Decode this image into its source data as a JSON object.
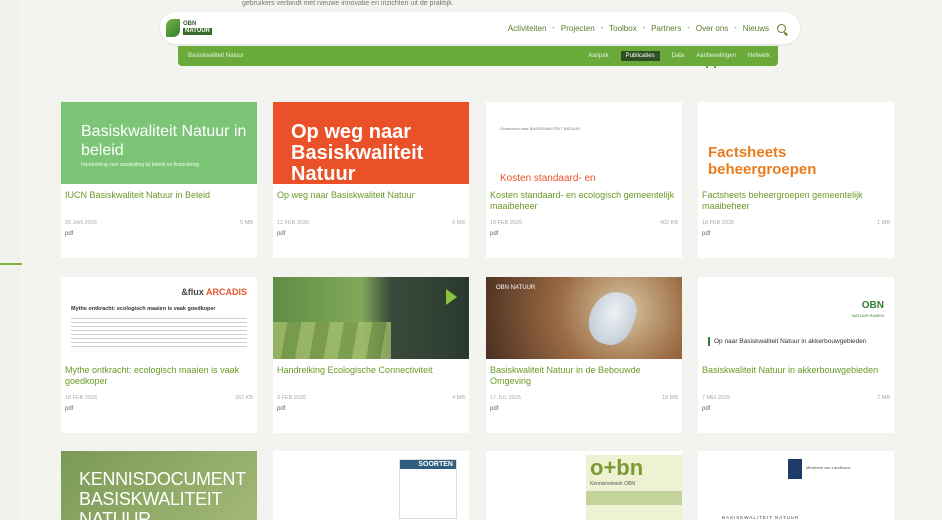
{
  "top_strip": "gebruikers verbindt met nieuwe innovatie en inzichten uit de praktijk.",
  "logo": {
    "line1": "OBN",
    "line2": "NATUUR"
  },
  "nav": {
    "items": [
      "Activiteiten",
      "Projecten",
      "Toolbox",
      "Partners",
      "Over ons",
      "Nieuws"
    ]
  },
  "subnav": {
    "title": "Basiskwaliteit Natuur",
    "tabs": [
      "Aanpak",
      "Publicaties",
      "Data",
      "Aanbevelingen",
      "Netwerk"
    ],
    "active_index": 1
  },
  "cards": [
    {
      "thumb": {
        "big": "Basiskwaliteit Natuur in beleid",
        "small": "Handreiking voor aansluiting bij beleid en financiering"
      },
      "title": "IUCN Basiskwaliteit Natuur in Beleid",
      "date": "20 JAN 2026",
      "size": "5 MB",
      "type": "pdf"
    },
    {
      "thumb": {
        "big": "Op weg naar Basiskwaliteit Natuur"
      },
      "title": "Op weg naar Basiskwaliteit Natuur",
      "date": "12 FEB 2026",
      "size": "6 MB",
      "type": "pdf"
    },
    {
      "thumb": {
        "tiny": "Onderzoek naar BASISKWALITEIT NATUUR",
        "orange": "Kosten standaard- en"
      },
      "title": "Kosten standaard- en ecologisch gemeentelijk maaibeheer",
      "date": "18 FEB 2026",
      "size": "402 KB",
      "type": "pdf"
    },
    {
      "thumb": {
        "orange": "Factsheets beheergroepen"
      },
      "title": "Factsheets beheergroepen gemeentelijk maaibeheer",
      "date": "18 FEB 2026",
      "size": "1 MB",
      "type": "pdf"
    },
    {
      "thumb": {
        "logo_a": "&flux",
        "logo_b": "ARCADIS",
        "head": "Mythe ontkracht: ecologisch maaien is vaak goedkoper"
      },
      "title": "Mythe ontkracht: ecologisch maaien is vaak goedkoper",
      "date": "18 FEB 2026",
      "size": "263 KB",
      "type": "pdf"
    },
    {
      "thumb": {},
      "title": "Handreiking Ecologische Connectiviteit",
      "date": "3 FEB 2026",
      "size": "4 MB",
      "type": "pdf"
    },
    {
      "thumb": {
        "logo": "OBN NATUUR"
      },
      "title": "Basiskwaliteit Natuur in de Bebouwde Omgeving",
      "date": "17 JUL 2025",
      "size": "18 MB",
      "type": "pdf"
    },
    {
      "thumb": {
        "obn": "OBN",
        "obn_sub": "NATUUR RAMEN",
        "text": "Op naar Basiskwaliteit Natuur in akkerbouwgebieden"
      },
      "title": "Basiskwaliteit Natuur in akkerbouwgebieden",
      "date": "7 MEI 2025",
      "size": "2 MB",
      "type": "pdf"
    },
    {
      "thumb": {
        "big": "KENNISDOCUMENT BASISKWALITEIT NATUUR"
      },
      "title": "",
      "date": "",
      "size": "",
      "type": ""
    },
    {
      "thumb": {
        "hd": "SOORTEN"
      },
      "title": "",
      "date": "",
      "size": "",
      "type": ""
    },
    {
      "thumb": {
        "big": "o+bn",
        "sub": "Kennisnetwerk OBN"
      },
      "title": "",
      "date": "",
      "size": "",
      "type": ""
    },
    {
      "thumb": {
        "min": "Ministerie van Landbouw",
        "low": "BASISKWALITEIT NATUUR"
      },
      "title": "",
      "date": "",
      "size": "",
      "type": ""
    }
  ]
}
